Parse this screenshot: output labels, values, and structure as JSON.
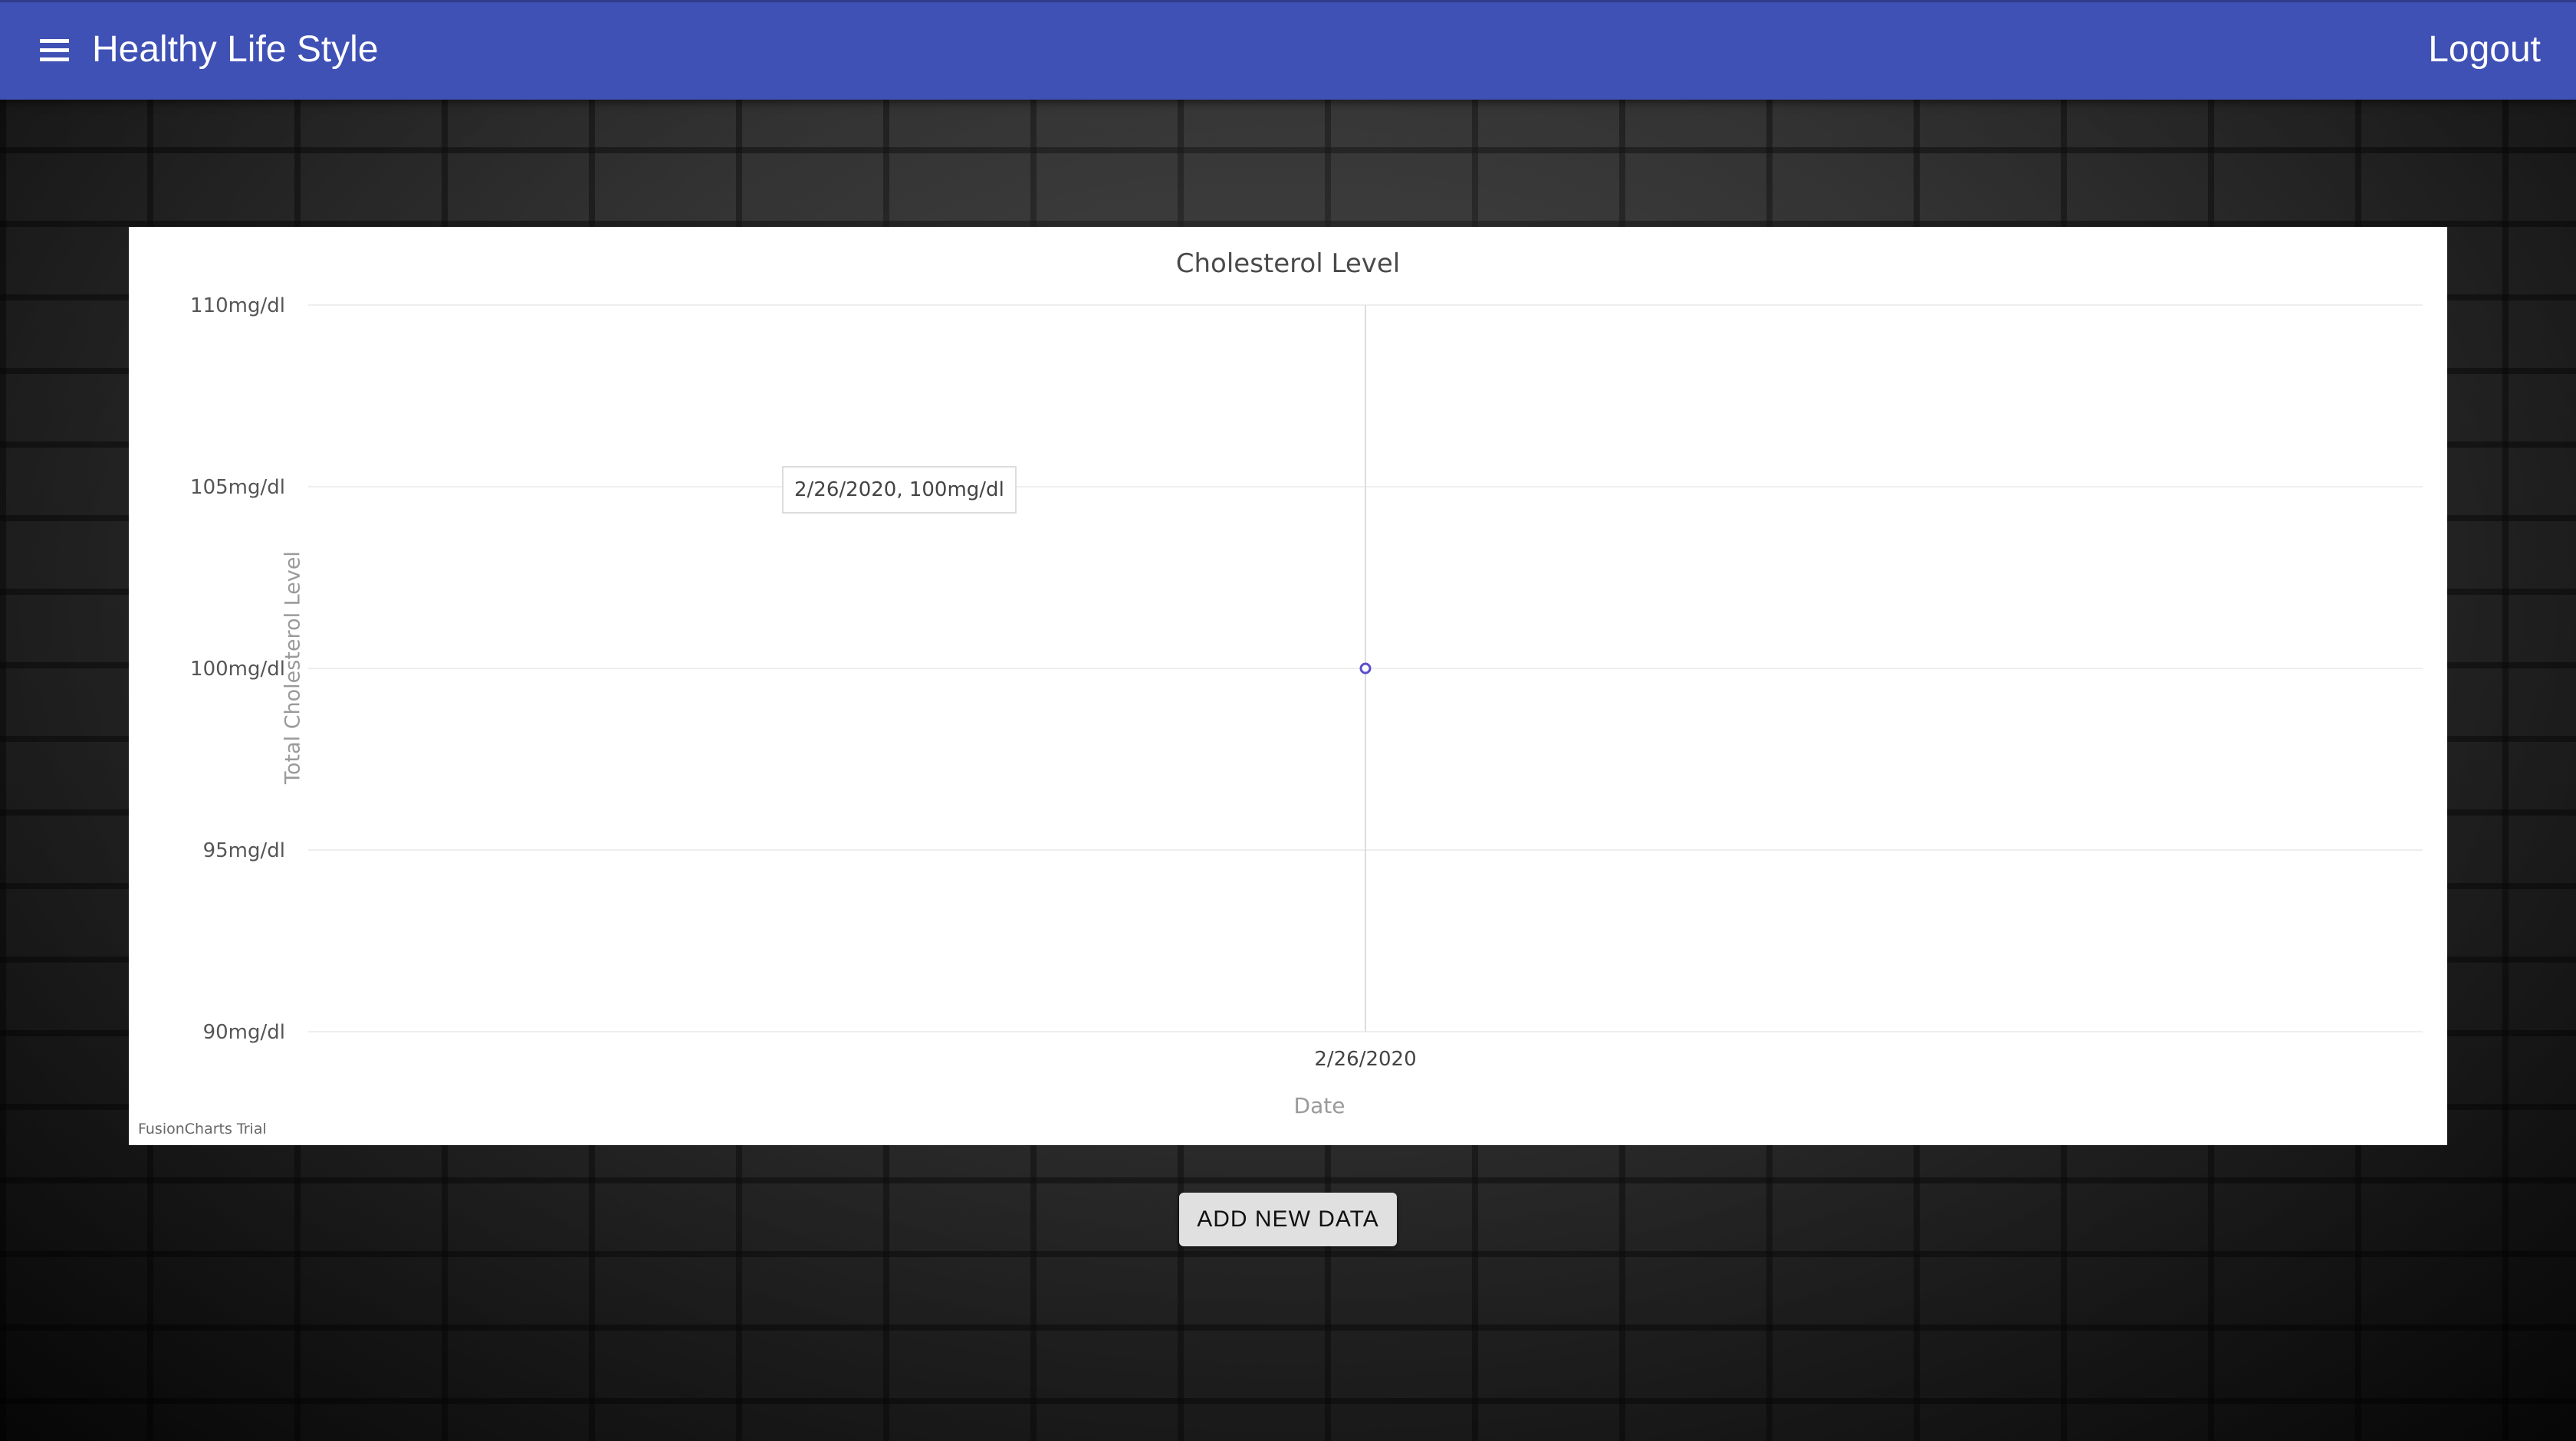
{
  "header": {
    "menu_icon": "menu-icon",
    "title": "Healthy Life Style",
    "logout_label": "Logout",
    "bar_color": "#3f51b5"
  },
  "chart_data": {
    "type": "line",
    "title": "Cholesterol Level",
    "xlabel": "Date",
    "ylabel": "Total Cholesterol Level",
    "categories": [
      "2/26/2020"
    ],
    "series": [
      {
        "values": [
          100
        ]
      }
    ],
    "ylim": [
      90,
      110
    ],
    "y_ticks": [
      110,
      105,
      100,
      95,
      90
    ],
    "y_tick_labels": [
      "110mg/dl",
      "105mg/dl",
      "100mg/dl",
      "95mg/dl",
      "90mg/dl"
    ],
    "grid": true,
    "marker_color": "#5a4fcf",
    "tooltip": "2/26/2020, 100mg/dl",
    "credit": "FusionCharts Trial"
  },
  "actions": {
    "add_new_data_label": "ADD NEW DATA"
  }
}
